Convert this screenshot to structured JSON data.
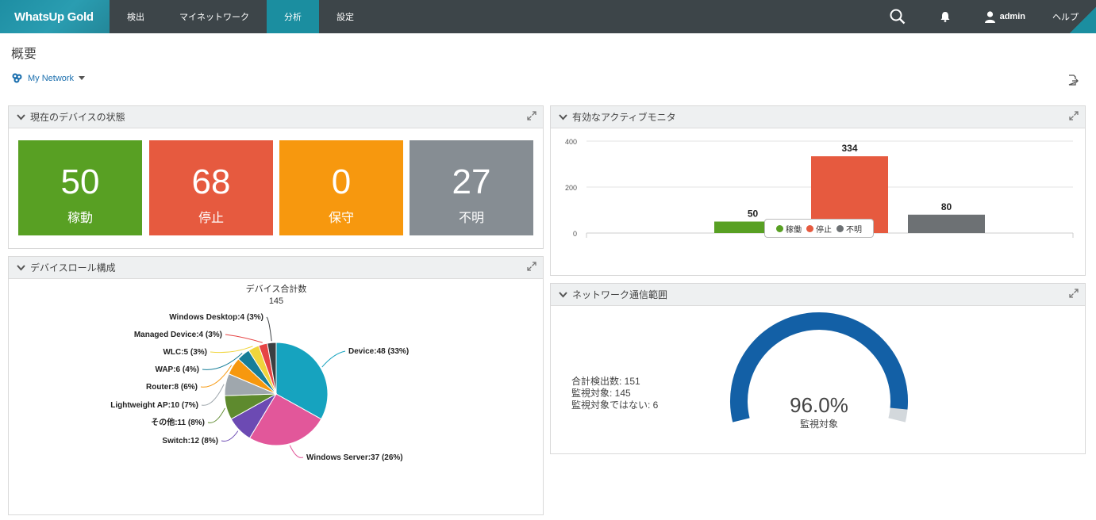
{
  "app": {
    "logo": "WhatsUp Gold"
  },
  "nav": {
    "items": [
      "検出",
      "マイネットワーク",
      "分析",
      "設定"
    ],
    "user": "admin",
    "help": "ヘルプ"
  },
  "page": {
    "title": "概要",
    "network": "My Network"
  },
  "device_status": {
    "title": "現在のデバイスの状態",
    "tiles": [
      {
        "value": "50",
        "label": "稼動",
        "color": "#58a023"
      },
      {
        "value": "68",
        "label": "停止",
        "color": "#e65a3f"
      },
      {
        "value": "0",
        "label": "保守",
        "color": "#f7980e"
      },
      {
        "value": "27",
        "label": "不明",
        "color": "#868d93"
      }
    ]
  },
  "active_monitors": {
    "title": "有効なアクティブモニタ",
    "chart_data": {
      "type": "bar",
      "categories": [
        "稼働",
        "停止",
        "不明"
      ],
      "values": [
        50,
        334,
        80
      ],
      "colors": [
        "#58a023",
        "#e65a3f",
        "#6d7174"
      ],
      "ylim": [
        0,
        400
      ],
      "yticks": [
        0,
        200,
        400
      ],
      "legend": "bottom-center"
    }
  },
  "device_roles": {
    "title": "デバイスロール構成",
    "chart_data": {
      "type": "pie",
      "title": "デバイス合計数",
      "subtitle": "145",
      "slices": [
        {
          "label": "Device:48 (33%)",
          "value": 48,
          "color": "#16a3bf"
        },
        {
          "label": "Windows Server:37 (26%)",
          "value": 37,
          "color": "#e2579a"
        },
        {
          "label": "Switch:12 (8%)",
          "value": 12,
          "color": "#6c4ab3"
        },
        {
          "label": "その他:11 (8%)",
          "value": 11,
          "color": "#5e8a2e"
        },
        {
          "label": "Lightweight AP:10 (7%)",
          "value": 10,
          "color": "#9fa7ad"
        },
        {
          "label": "Router:8 (6%)",
          "value": 8,
          "color": "#f7980e"
        },
        {
          "label": "WAP:6 (4%)",
          "value": 6,
          "color": "#177e98"
        },
        {
          "label": "WLC:5 (3%)",
          "value": 5,
          "color": "#f0d53c"
        },
        {
          "label": "Managed Device:4 (3%)",
          "value": 4,
          "color": "#e64545"
        },
        {
          "label": "Windows Desktop:4 (3%)",
          "value": 4,
          "color": "#3b3f42"
        }
      ]
    }
  },
  "network_coverage": {
    "title": "ネットワーク通信範囲",
    "stats": [
      "合計検出数: 151",
      "監視対象: 145",
      "監視対象ではない: 6"
    ],
    "percent_text": "96.0%",
    "percent_label": "監視対象",
    "chart_data": {
      "type": "gauge",
      "value": 96.0,
      "max": 100,
      "color": "#1360a6",
      "track_color": "#d3d8dc"
    }
  }
}
